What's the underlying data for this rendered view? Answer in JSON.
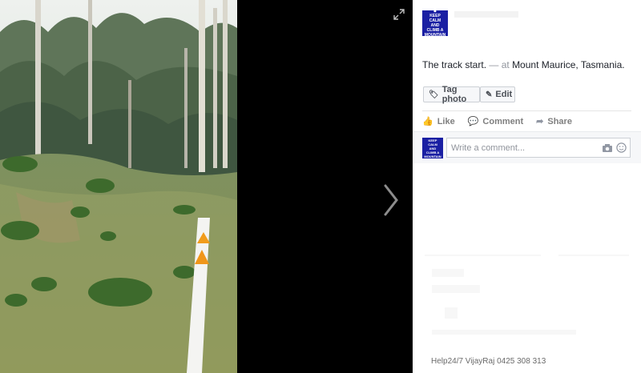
{
  "viewer": {
    "expand_icon": "expand-icon",
    "next_icon": "chevron-right-icon"
  },
  "post": {
    "author_avatar_text": [
      "KEEP",
      "CALM",
      "AND",
      "CLIMB A",
      "MOUNTAIN"
    ],
    "caption": "The track start.",
    "location_prefix": "— at",
    "location": "Mount Maurice, Tasmania."
  },
  "buttons": {
    "tag_photo": "Tag photo",
    "edit": "Edit"
  },
  "actions": {
    "like": "Like",
    "comment": "Comment",
    "share": "Share"
  },
  "comment": {
    "placeholder": "Write a comment..."
  },
  "footer": {
    "text": "Help24/7 VijayRaj 0425 308 313"
  },
  "colors": {
    "avatar_bg": "#1a1fa3",
    "panel_bg": "#ffffff",
    "stage_bg": "#000000"
  }
}
